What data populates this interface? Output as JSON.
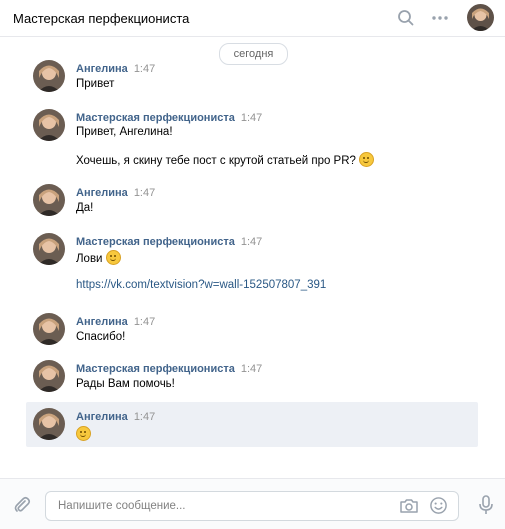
{
  "header": {
    "title": "Мастерская перфекциониста"
  },
  "date_separator": "сегодня",
  "messages": [
    {
      "author": "Ангелина",
      "time": "1:47",
      "lines": [
        "Привет"
      ]
    },
    {
      "author": "Мастерская перфекциониста",
      "time": "1:47",
      "lines": [
        "Привет, Ангелина!",
        "Хочешь, я скину тебе пост с крутой статьей про PR?"
      ]
    },
    {
      "author": "Ангелина",
      "time": "1:47",
      "lines": [
        "Да!"
      ]
    },
    {
      "author": "Мастерская перфекциониста",
      "time": "1:47",
      "lines": [
        "Лови",
        "https://vk.com/textvision?w=wall-152507807_391"
      ]
    },
    {
      "author": "Ангелина",
      "time": "1:47",
      "lines": [
        "Спасибо!"
      ]
    },
    {
      "author": "Мастерская перфекциониста",
      "time": "1:47",
      "lines": [
        "Рады Вам помочь!"
      ]
    },
    {
      "author": "Ангелина",
      "time": "1:47",
      "lines": [
        ""
      ]
    }
  ],
  "composer": {
    "placeholder": "Напишите сообщение..."
  },
  "colors": {
    "link": "#2a5885",
    "author": "#42648b",
    "highlight": "#edf0f5"
  }
}
